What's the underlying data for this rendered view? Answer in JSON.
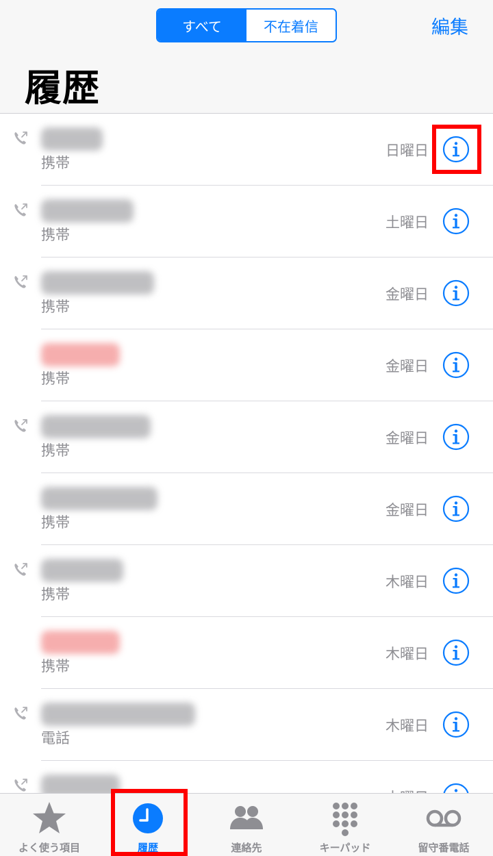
{
  "header": {
    "segments": [
      {
        "label": "すべて",
        "active": true
      },
      {
        "label": "不在着信",
        "active": false
      }
    ],
    "edit_label": "編集",
    "title": "履歴"
  },
  "calls": [
    {
      "type": "携帯",
      "day": "日曜日",
      "outgoing": true,
      "missed": false
    },
    {
      "type": "携帯",
      "day": "土曜日",
      "outgoing": true,
      "missed": false
    },
    {
      "type": "携帯",
      "day": "金曜日",
      "outgoing": true,
      "missed": false
    },
    {
      "type": "携帯",
      "day": "金曜日",
      "outgoing": false,
      "missed": true
    },
    {
      "type": "携帯",
      "day": "金曜日",
      "outgoing": true,
      "missed": false
    },
    {
      "type": "携帯",
      "day": "金曜日",
      "outgoing": false,
      "missed": false
    },
    {
      "type": "携帯",
      "day": "木曜日",
      "outgoing": true,
      "missed": false
    },
    {
      "type": "携帯",
      "day": "木曜日",
      "outgoing": false,
      "missed": true
    },
    {
      "type": "電話",
      "day": "木曜日",
      "outgoing": true,
      "missed": false
    },
    {
      "type": "",
      "day": "木曜日",
      "outgoing": true,
      "missed": false
    }
  ],
  "tabs": [
    {
      "label": "よく使う項目",
      "icon": "star-icon",
      "active": false
    },
    {
      "label": "履歴",
      "icon": "clock-icon",
      "active": true
    },
    {
      "label": "連絡先",
      "icon": "contacts-icon",
      "active": false
    },
    {
      "label": "キーパッド",
      "icon": "keypad-icon",
      "active": false
    },
    {
      "label": "留守番電話",
      "icon": "voicemail-icon",
      "active": false
    }
  ],
  "colors": {
    "accent": "#0a7cff",
    "highlight": "#ff0000",
    "secondary_text": "#8e8e93"
  }
}
